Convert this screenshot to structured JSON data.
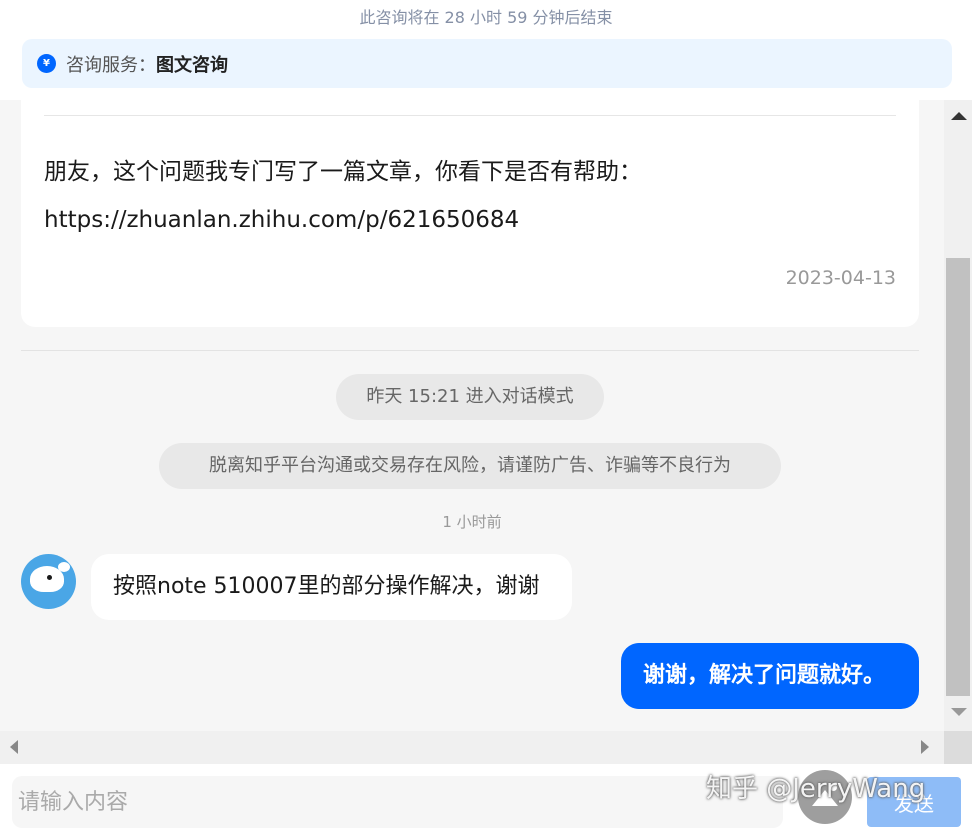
{
  "header": {
    "countdown": "此咨询将在 28 小时 59 分钟后结束",
    "service_icon": "yen-icon",
    "service_label": "咨询服务：",
    "service_value": "图文咨询"
  },
  "article_card": {
    "line1": "朋友，这个问题我专门写了一篇文章，你看下是否有帮助：",
    "line2": "https://zhuanlan.zhihu.com/p/621650684",
    "date": "2023-04-13"
  },
  "system_messages": {
    "mode_notice": "昨天 15:21 进入对话模式",
    "risk_warning": "脱离知乎平台沟通或交易存在风险，请谨防广告、诈骗等不良行为",
    "relative_time": "1 小时前"
  },
  "messages": [
    {
      "direction": "incoming",
      "text": "按照note 510007里的部分操作解决，谢谢"
    },
    {
      "direction": "outgoing",
      "text": "谢谢，解决了问题就好。"
    }
  ],
  "composer": {
    "placeholder": "请输入内容",
    "send_label": "发送"
  },
  "watermark": "知乎 @JerryWang",
  "colors": {
    "accent": "#0066ff",
    "service_bar_bg": "#ebf5ff",
    "chat_bg": "#f6f6f6",
    "send_disabled": "#8ebcf7"
  }
}
